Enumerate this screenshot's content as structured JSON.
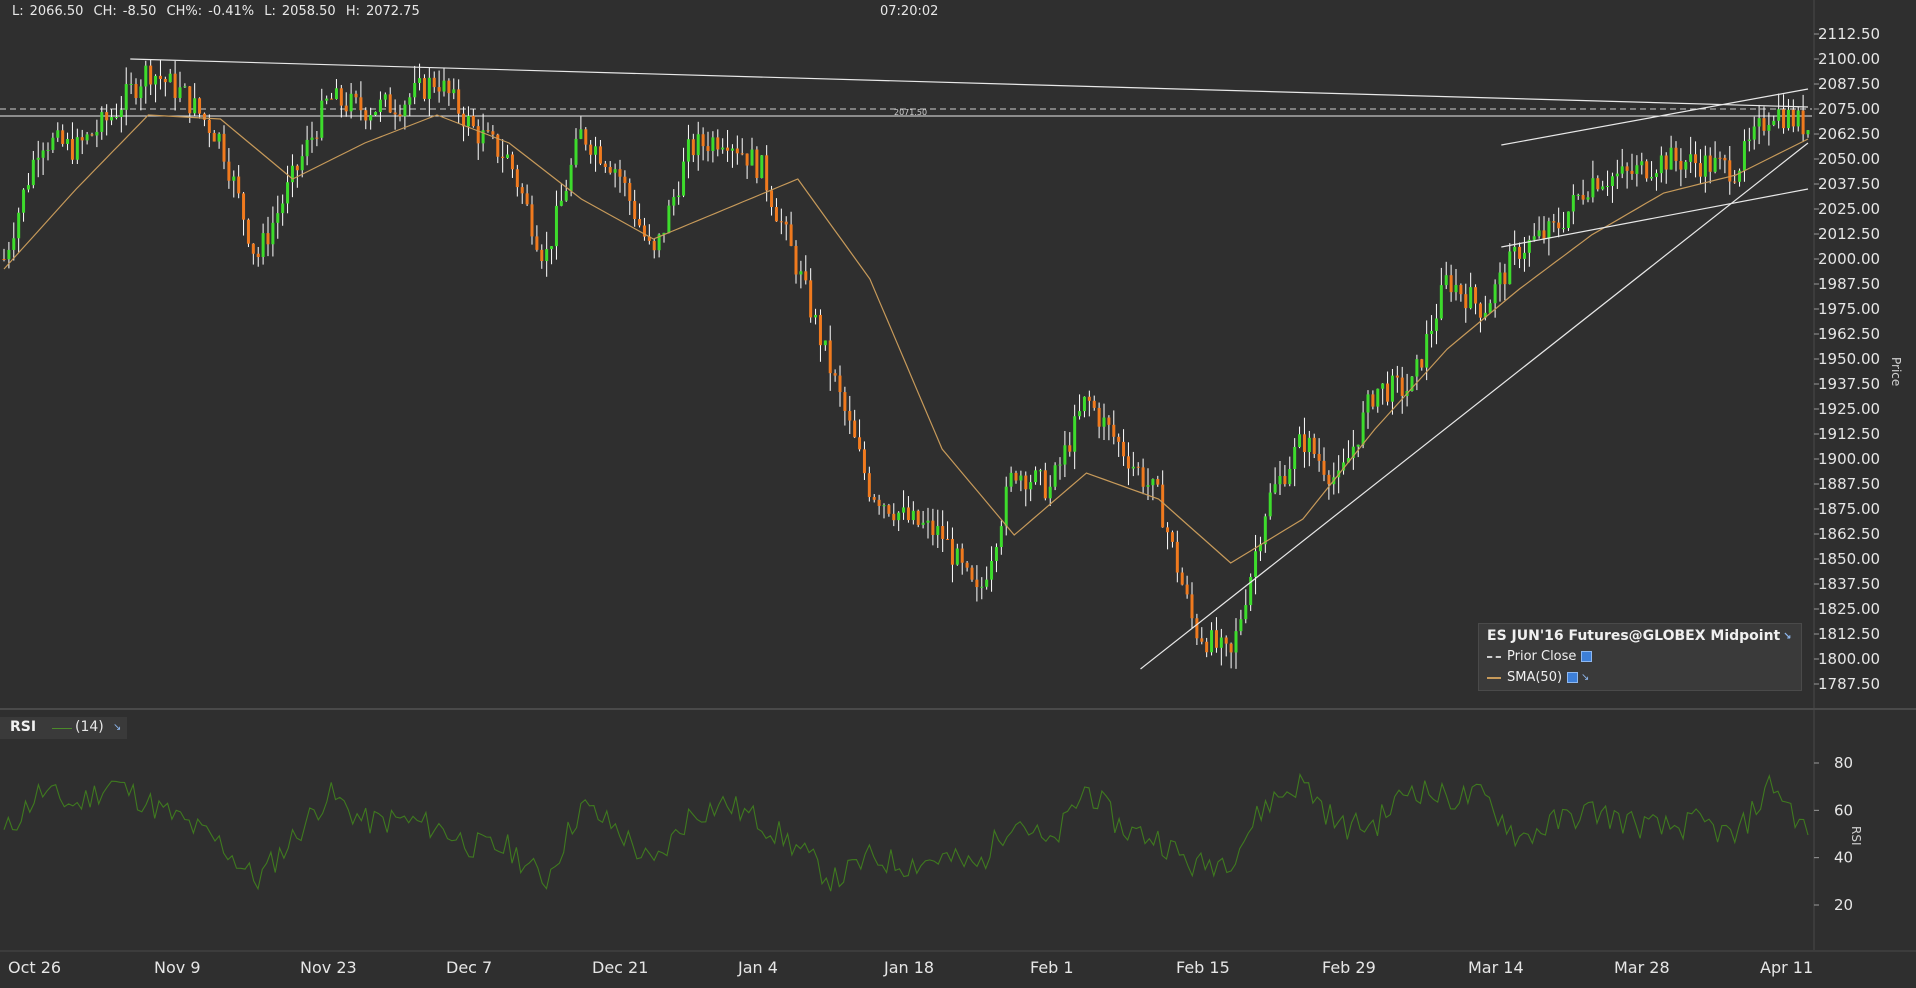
{
  "header": {
    "last_label": "L:",
    "last_value": "2066.50",
    "ch_label": "CH:",
    "ch_value": "-8.50",
    "chp_label": "CH%:",
    "chp_value": "-0.41%",
    "low_label": "L:",
    "low_value": "2058.50",
    "high_label": "H:",
    "high_value": "2072.75",
    "clock": "07:20:02"
  },
  "legend": {
    "title": "ES JUN'16 Futures@GLOBEX Midpoint",
    "prior_close": "Prior Close",
    "sma": "SMA(50)"
  },
  "rsi_panel": {
    "label": "RSI",
    "period": "(14)"
  },
  "colors": {
    "background": "#2f2f2f",
    "up_candle": "#3ddc2c",
    "down_candle": "#f07a1e",
    "wick": "#ffffff",
    "sma": "#c79a5a",
    "rsi": "#3f7a1f",
    "trendline": "#e8e8e8"
  },
  "chart_data": [
    {
      "type": "line",
      "ylabel": "Price",
      "ylim": [
        1780,
        2120
      ],
      "y_ticks": [
        "2112.50",
        "2100.00",
        "2087.50",
        "2075.00",
        "2062.50",
        "2050.00",
        "2037.50",
        "2025.00",
        "2012.50",
        "2000.00",
        "1987.50",
        "1975.00",
        "1962.50",
        "1950.00",
        "1937.50",
        "1925.00",
        "1912.50",
        "1900.00",
        "1887.50",
        "1875.00",
        "1862.50",
        "1850.00",
        "1837.50",
        "1825.00",
        "1812.50",
        "1800.00",
        "1787.50"
      ],
      "x_ticks": [
        "Oct 26",
        "Nov 9",
        "Nov 23",
        "Dec 7",
        "Dec 21",
        "Jan 4",
        "Jan 18",
        "Feb 1",
        "Feb 15",
        "Feb 29",
        "Mar 14",
        "Mar 28",
        "Apr 11"
      ],
      "x_index_range": [
        0,
        100
      ],
      "prior_close": 2075.0,
      "center_label": "2071.50",
      "series": [
        {
          "name": "ES JUN'16 Futures@GLOBEX Midpoint",
          "x": [
            0,
            2,
            4,
            6,
            8,
            10,
            12,
            14,
            16,
            18,
            20,
            22,
            24,
            26,
            28,
            30,
            32,
            34,
            36,
            38,
            40,
            42,
            44,
            46,
            48,
            50,
            52,
            54,
            56,
            58,
            60,
            62,
            64,
            66,
            68,
            70,
            72,
            74,
            76,
            78,
            80,
            82,
            84,
            86,
            88,
            90,
            92,
            94,
            96,
            98,
            100
          ],
          "values": [
            2000,
            2060,
            2055,
            2072,
            2095,
            2082,
            2060,
            2000,
            2040,
            2080,
            2075,
            2078,
            2090,
            2065,
            2050,
            2000,
            2063,
            2045,
            2000,
            2055,
            2062,
            2045,
            1995,
            1940,
            1885,
            1870,
            1862,
            1830,
            1895,
            1885,
            1930,
            1905,
            1880,
            1815,
            1800,
            1878,
            1910,
            1888,
            1935,
            1935,
            1990,
            1975,
            2005,
            2015,
            2040,
            2042,
            2050,
            2048,
            2045,
            2075,
            2066
          ]
        },
        {
          "name": "SMA(50)",
          "x": [
            0,
            4,
            8,
            12,
            16,
            20,
            24,
            28,
            32,
            36,
            40,
            44,
            48,
            52,
            56,
            60,
            64,
            68,
            72,
            76,
            80,
            84,
            88,
            92,
            96,
            100
          ],
          "values": [
            1995,
            2035,
            2072,
            2070,
            2040,
            2058,
            2072,
            2058,
            2030,
            2010,
            2025,
            2040,
            1990,
            1905,
            1862,
            1893,
            1880,
            1848,
            1870,
            1915,
            1955,
            1985,
            2012,
            2033,
            2042,
            2060
          ]
        }
      ],
      "trendlines": [
        {
          "from": [
            7,
            2100
          ],
          "to": [
            100,
            2076
          ]
        },
        {
          "from": [
            63,
            1795
          ],
          "to": [
            100,
            2058
          ]
        },
        {
          "from": [
            83,
            2006
          ],
          "to": [
            100,
            2035
          ]
        },
        {
          "from": [
            83,
            2057
          ],
          "to": [
            100,
            2085
          ]
        }
      ]
    },
    {
      "type": "line",
      "ylabel": "RSI",
      "ylim": [
        10,
        90
      ],
      "y_ticks": [
        "80",
        "60",
        "40",
        "20"
      ],
      "series": [
        {
          "name": "(14)",
          "x": [
            0,
            2,
            4,
            6,
            8,
            10,
            12,
            14,
            16,
            18,
            20,
            22,
            24,
            26,
            28,
            30,
            32,
            34,
            36,
            38,
            40,
            42,
            44,
            46,
            48,
            50,
            52,
            54,
            56,
            58,
            60,
            62,
            64,
            66,
            68,
            70,
            72,
            74,
            76,
            78,
            80,
            82,
            84,
            86,
            88,
            90,
            92,
            94,
            96,
            98,
            100
          ],
          "values": [
            50,
            68,
            62,
            72,
            63,
            55,
            46,
            30,
            48,
            67,
            55,
            56,
            53,
            45,
            44,
            30,
            62,
            52,
            36,
            58,
            63,
            55,
            44,
            30,
            40,
            37,
            40,
            36,
            58,
            44,
            70,
            52,
            48,
            36,
            40,
            63,
            72,
            53,
            54,
            70,
            65,
            66,
            48,
            55,
            60,
            55,
            52,
            55,
            48,
            72,
            50
          ]
        }
      ]
    }
  ]
}
